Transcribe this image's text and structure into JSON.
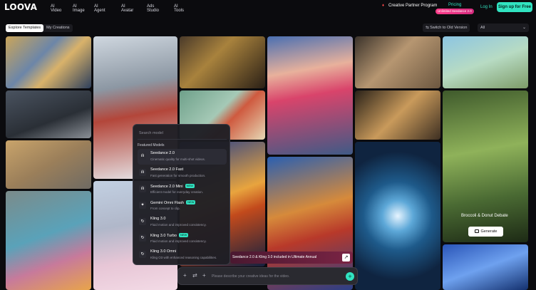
{
  "header": {
    "logo": "LOOVA",
    "nav": [
      "AI Video",
      "AI Image",
      "AI Agent",
      "AI Avatar",
      "Ads Studio",
      "AI Tools"
    ],
    "partner": "Creative Partner Program",
    "pricing": "Pricing",
    "unlimited_badge": "Unlimited Seedance 2.0",
    "login": "Log In",
    "signup": "Sign up for Free"
  },
  "toolbar": {
    "tabs": [
      "Explore Templates",
      "My Creations"
    ],
    "switch_old": "Switch to Old Version",
    "filter_value": "All"
  },
  "model_menu": {
    "search_placeholder": "Search model",
    "section": "Featured Models",
    "items": [
      {
        "name": "Seedance 2.0",
        "desc": "Cinematic quality for multi-shot videos.",
        "new": false
      },
      {
        "name": "Seedance 2.0 Fast",
        "desc": "Fast generation for smooth production.",
        "new": false
      },
      {
        "name": "Seedance 2.0 Mini",
        "desc": "Efficient model for everyday creation.",
        "new": true
      },
      {
        "name": "Gemini Omni Flash",
        "desc": "From concept to clip.",
        "new": true
      },
      {
        "name": "Kling 3.0",
        "desc": "Fluid motion and improved consistency.",
        "new": false
      },
      {
        "name": "Kling 3.0 Turbo",
        "desc": "Fluid motion and improved consistency.",
        "new": true
      },
      {
        "name": "Kling 3.0 Omni",
        "desc": "Kling O3 with enhanced reasoning capabilities.",
        "new": false
      }
    ],
    "new_label": "NEW"
  },
  "promo": {
    "title": "Broccoli & Donut Debate",
    "button": "Generate"
  },
  "banner": {
    "text": "Seedance 2.0 & Kling 3.0 included in Ultimate Annual"
  },
  "prompt": {
    "placeholder": "Please describe your creative ideas for the video."
  },
  "colors": {
    "accent": "#31e3c1",
    "badge_pink": "#ff3d8b"
  }
}
